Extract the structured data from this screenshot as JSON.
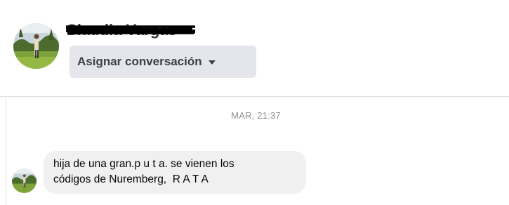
{
  "header": {
    "contact_name": "Claudia Vargas",
    "assign_button_label": "Asignar conversación",
    "assign_icon": "caret-down-icon"
  },
  "thread": {
    "timestamp": "MAR, 21:37",
    "messages": [
      {
        "lines": [
          "hija de una gran.p u t a. se vienen los",
          "códigos de Nuremberg,  R A T A"
        ]
      }
    ]
  },
  "colors": {
    "assign_button_bg": "#e4e6eb",
    "bubble_bg": "#f0f0f0",
    "timestamp_text": "#8a8d91",
    "divider": "#dddfe2"
  }
}
